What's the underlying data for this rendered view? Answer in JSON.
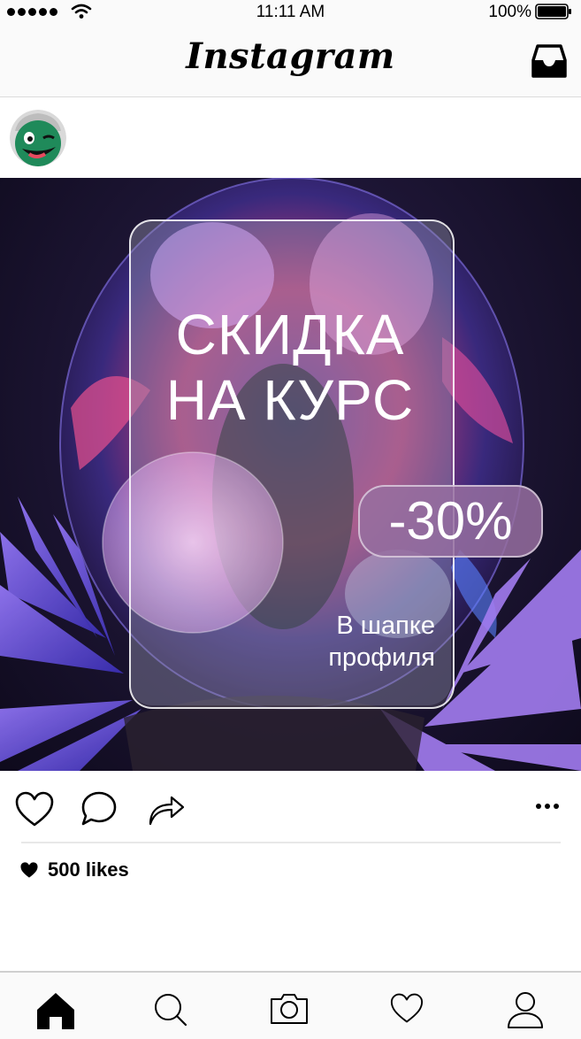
{
  "status_bar": {
    "time": "11:11 AM",
    "battery": "100%",
    "icons": [
      "signal-dots-icon",
      "wifi-icon",
      "battery-icon"
    ]
  },
  "header": {
    "logo_text": "Instagram",
    "right_icon": "inbox-icon"
  },
  "post": {
    "headline": [
      "СКИДКА",
      "НА КУРС"
    ],
    "discount": "-30%",
    "subtext": [
      "В шапке",
      "профиля"
    ]
  },
  "actions": {
    "icons": [
      "heart-icon",
      "comment-icon",
      "share-icon",
      "more-icon"
    ]
  },
  "likes": {
    "label": "500 likes"
  },
  "tabbar": {
    "icons": [
      "home-icon",
      "search-icon",
      "camera-icon",
      "activity-heart-icon",
      "profile-icon"
    ]
  },
  "colors": {
    "post_background": "#1e1636",
    "discount_pill": "#966ea0",
    "avatar_green": "#1f8a5a"
  }
}
